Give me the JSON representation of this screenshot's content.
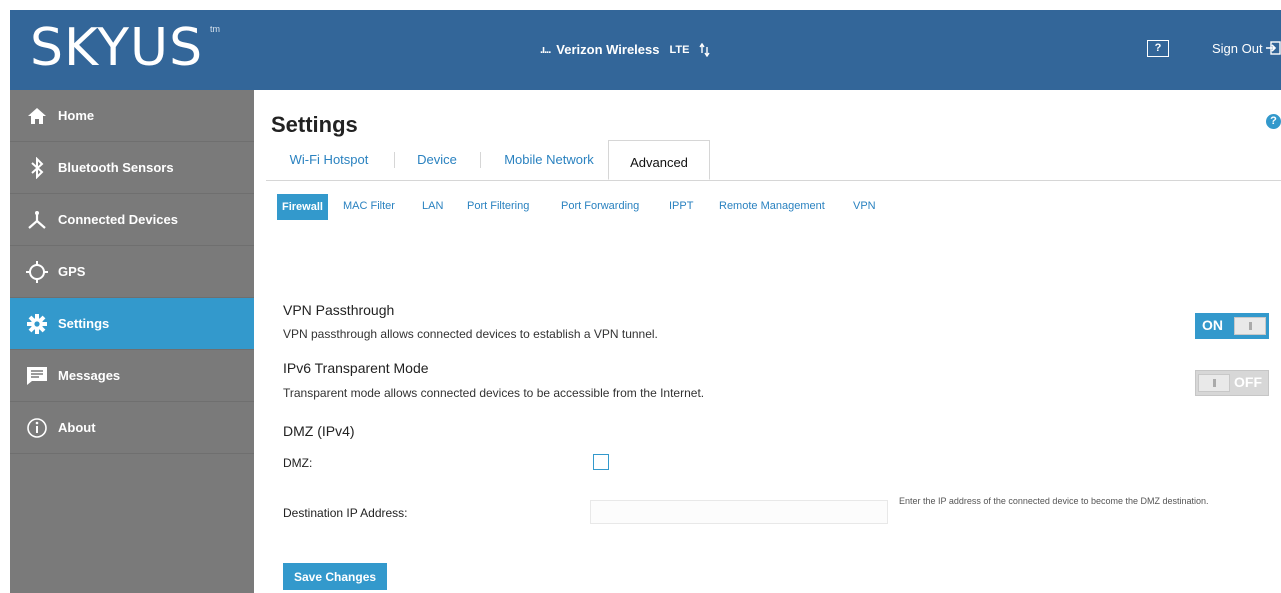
{
  "header": {
    "logo": "SKYUS",
    "logo_tm": "tm",
    "signal": ".ı...",
    "carrier": "Verizon Wireless",
    "network_type": "LTE",
    "help_label": "?",
    "signout_label": "Sign Out"
  },
  "sidebar": {
    "items": [
      {
        "label": "Home",
        "icon": "home-icon"
      },
      {
        "label": "Bluetooth Sensors",
        "icon": "bluetooth-icon"
      },
      {
        "label": "Connected Devices",
        "icon": "connected-devices-icon"
      },
      {
        "label": "GPS",
        "icon": "gps-icon"
      },
      {
        "label": "Settings",
        "icon": "gear-icon",
        "active": true
      },
      {
        "label": "Messages",
        "icon": "message-icon"
      },
      {
        "label": "About",
        "icon": "info-icon"
      }
    ]
  },
  "main": {
    "title": "Settings",
    "help_label": "?",
    "tabs": [
      {
        "label": "Wi-Fi Hotspot"
      },
      {
        "label": "Device"
      },
      {
        "label": "Mobile Network"
      },
      {
        "label": "Advanced",
        "active": true
      }
    ],
    "subtabs": [
      {
        "label": "Firewall",
        "active": true
      },
      {
        "label": "MAC Filter"
      },
      {
        "label": "LAN"
      },
      {
        "label": "Port Filtering"
      },
      {
        "label": "Port Forwarding"
      },
      {
        "label": "IPPT"
      },
      {
        "label": "Remote Management"
      },
      {
        "label": "VPN"
      }
    ],
    "vpn": {
      "title": "VPN Passthrough",
      "description": "VPN passthrough allows connected devices to establish a VPN tunnel.",
      "toggle_label": "ON",
      "enabled": true
    },
    "ipv6": {
      "title": "IPv6 Transparent Mode",
      "description": "Transparent mode allows connected devices to be accessible from the Internet.",
      "toggle_label": "OFF",
      "enabled": false
    },
    "dmz": {
      "title": "DMZ (IPv4)",
      "checkbox_label": "DMZ:",
      "checked": false,
      "ip_label": "Destination IP Address:",
      "ip_value": "",
      "ip_hint": "Enter the IP address of the connected device to become the DMZ destination."
    },
    "save_label": "Save Changes"
  },
  "colors": {
    "header": "#336699",
    "sidebar": "#7a7a7a",
    "accent": "#3399cc"
  }
}
